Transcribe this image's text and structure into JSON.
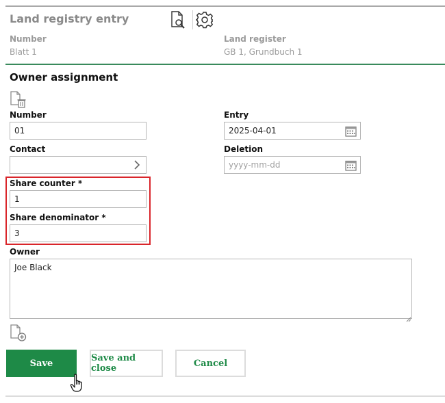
{
  "header": {
    "title": "Land registry entry",
    "number_label": "Number",
    "number_value": "Blatt 1",
    "register_label": "Land register",
    "register_value": "GB 1, Grundbuch 1"
  },
  "section": {
    "title": "Owner assignment"
  },
  "form": {
    "number_label": "Number",
    "number_value": "01",
    "entry_label": "Entry",
    "entry_value": "2025-04-01",
    "contact_label": "Contact",
    "contact_value": "",
    "deletion_label": "Deletion",
    "deletion_placeholder": "yyyy-mm-dd",
    "share_counter_label": "Share counter *",
    "share_counter_value": "1",
    "share_denominator_label": "Share denominator *",
    "share_denominator_value": "3",
    "owner_label": "Owner",
    "owner_value": "Joe Black"
  },
  "buttons": {
    "save": "Save",
    "save_close": "Save and close",
    "cancel": "Cancel"
  },
  "icons": {
    "preview": "document-search-icon",
    "settings": "gear-icon",
    "delete_doc": "document-delete-icon",
    "add_doc": "document-add-icon",
    "calendar": "calendar-icon",
    "chevron": "chevron-right-icon",
    "cursor": "hand-pointer-icon"
  },
  "colors": {
    "accent_green": "#1e8a47",
    "highlight_red": "#d9252a",
    "muted_text": "#8a8a8a"
  }
}
